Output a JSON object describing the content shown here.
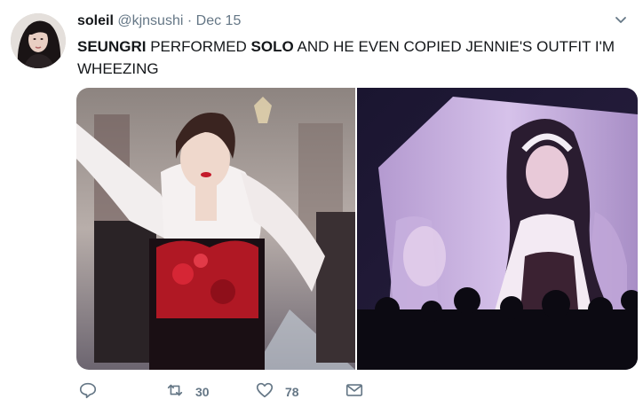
{
  "tweet": {
    "author_name": "soleil",
    "handle": "@kjnsushi",
    "separator": "·",
    "date": "Dec 15",
    "text": {
      "part1_bold": "SEUNGRI",
      "part2": " PERFORMED ",
      "part3_bold": "SOLO",
      "part4": " AND HE EVEN COPIED JENNIE'S OUTFIT I'M WHEEZING"
    },
    "retweet_count": "30",
    "like_count": "78"
  },
  "icons": {
    "reply": "speech-bubble-icon",
    "retweet": "retweet-arrows-icon",
    "like": "heart-icon",
    "message": "envelope-icon",
    "menu": "chevron-down-icon"
  },
  "colors": {
    "text": "#14171a",
    "secondary": "#657786",
    "icon": "#657786"
  }
}
